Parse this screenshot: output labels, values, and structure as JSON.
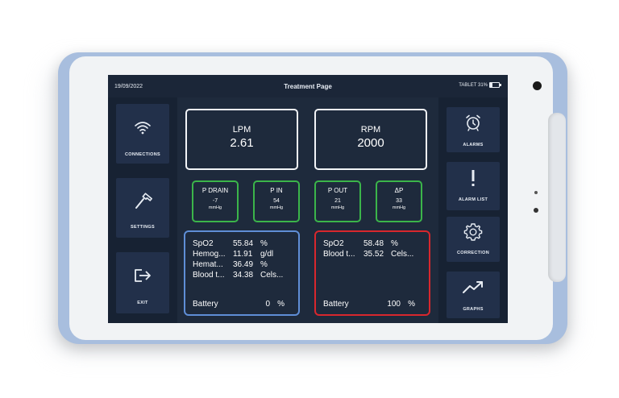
{
  "header": {
    "date": "19/09/2022",
    "title": "Treatment Page",
    "device_status": "TABLET 31%",
    "battery_level": 0.31
  },
  "left_nav": [
    {
      "label": "CONNECTIONS",
      "icon": "wifi-icon"
    },
    {
      "label": "SETTINGS",
      "icon": "hammer-icon"
    },
    {
      "label": "EXIT",
      "icon": "exit-icon"
    }
  ],
  "right_nav": [
    {
      "label": "ALARMS",
      "icon": "alarm-clock-icon"
    },
    {
      "label": "ALARM LIST",
      "icon": "exclamation-icon"
    },
    {
      "label": "CORRECTION",
      "icon": "gear-icon"
    },
    {
      "label": "GRAPHS",
      "icon": "trend-up-icon"
    }
  ],
  "primary": {
    "lpm": {
      "label": "LPM",
      "value": "2.61"
    },
    "rpm": {
      "label": "RPM",
      "value": "2000"
    }
  },
  "pressures": [
    {
      "label": "P DRAIN",
      "value": "-7",
      "unit": "mmHg"
    },
    {
      "label": "P IN",
      "value": "54",
      "unit": "mmHg"
    },
    {
      "label": "P OUT",
      "value": "21",
      "unit": "mmHg"
    },
    {
      "label": "ΔP",
      "value": "33",
      "unit": "mmHg"
    }
  ],
  "sensor_left": {
    "rows": [
      {
        "name": "SpO2",
        "value": "55.84",
        "unit": "%"
      },
      {
        "name": "Hemog...",
        "value": "11.91",
        "unit": "g/dl"
      },
      {
        "name": "Hemat...",
        "value": "36.49",
        "unit": "%"
      },
      {
        "name": "Blood t...",
        "value": "34.38",
        "unit": "Cels..."
      }
    ],
    "battery": {
      "name": "Battery",
      "value": "0",
      "unit": "%"
    }
  },
  "sensor_right": {
    "rows": [
      {
        "name": "SpO2",
        "value": "58.48",
        "unit": "%"
      },
      {
        "name": "Blood t...",
        "value": "35.52",
        "unit": "Cels..."
      }
    ],
    "battery": {
      "name": "Battery",
      "value": "100",
      "unit": "%"
    }
  },
  "colors": {
    "screen_bg": "#1e2a3c",
    "pressure_border": "#3bb54a",
    "sensor_left_border": "#5f8ed6",
    "sensor_right_border": "#d8272d",
    "frame": "#a8bede"
  }
}
